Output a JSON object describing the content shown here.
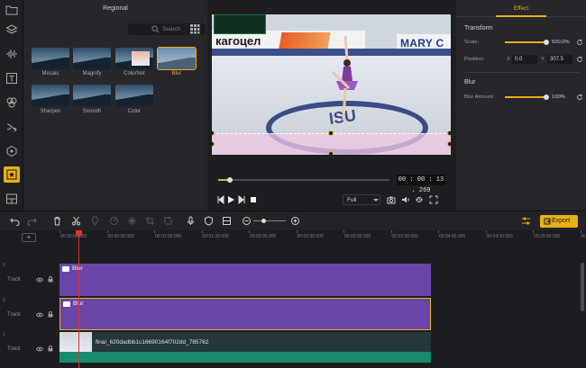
{
  "effects_panel": {
    "title": "Regional",
    "search_placeholder": "Search",
    "items": [
      {
        "label": "Mosaic"
      },
      {
        "label": "Magnify"
      },
      {
        "label": "ColorNot"
      },
      {
        "label": "Blur"
      },
      {
        "label": "Sharpen"
      },
      {
        "label": "Smooth"
      },
      {
        "label": "Color"
      }
    ],
    "selected": "Blur"
  },
  "video": {
    "banner_left_text": "кагоцел",
    "banner_right_text": "MARY C",
    "ring_text": "ISU"
  },
  "player": {
    "timecode": "00 : 00 : 13 . 269",
    "progress": 0.07,
    "zoom_select": "Full"
  },
  "properties": {
    "tab": "Effect",
    "transform_heading": "Transform",
    "scale_label": "Scale:",
    "scale_value": "500.0%",
    "scale_fraction": 1.0,
    "position_label": "Position:",
    "pos_x_label": "X",
    "pos_x": "0.0",
    "pos_y_label": "Y",
    "pos_y": "307.5",
    "blur_heading": "Blur",
    "blur_amount_label": "Blur Amount:",
    "blur_amount_value": "100%",
    "blur_fraction": 1.0
  },
  "toolbar": {
    "export_label": "Export",
    "zoom_level_fraction": 0.3
  },
  "timeline": {
    "add_track": "+",
    "ticks": [
      "00:00:00.000",
      "00:00:30.000",
      "00:01:00.000",
      "00:01:30.000",
      "00:02:00.000",
      "00:02:30.000",
      "00:03:00.000",
      "00:03:30.000",
      "00:04:00.000",
      "00:04:30.000",
      "00:05:00.000",
      "00:05:30.000"
    ],
    "tracks": [
      {
        "num": "3",
        "name": "Track",
        "clip_name": "Blur"
      },
      {
        "num": "2",
        "name": "Track",
        "clip_name": "Blur"
      },
      {
        "num": "1",
        "name": "Track",
        "clip_name": "final_620dadbb1c16690164f702dd_785762"
      }
    ]
  },
  "colors": {
    "accent": "#e8b014",
    "clip_purple": "#6a45a8",
    "audio_green": "#1a8a6e",
    "playhead": "#e0302a"
  }
}
